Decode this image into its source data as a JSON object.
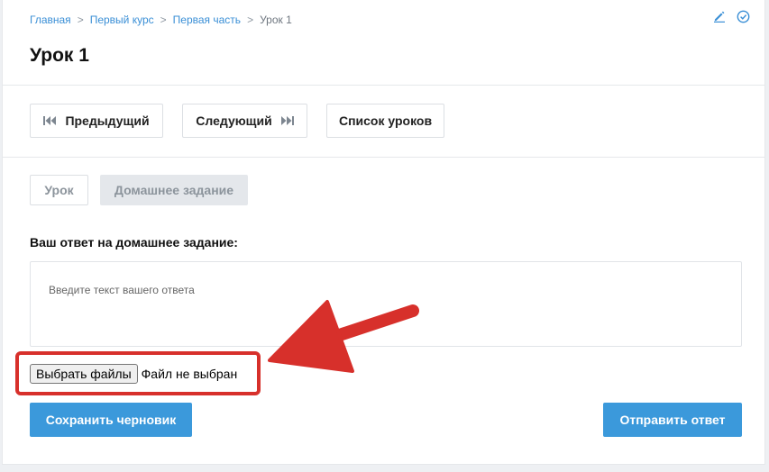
{
  "breadcrumb": {
    "items": [
      "Главная",
      "Первый курс",
      "Первая часть"
    ],
    "current": "Урок 1",
    "separator": ">"
  },
  "header": {
    "title": "Урок 1",
    "icons": [
      "pencil-icon",
      "check-circle-icon"
    ]
  },
  "nav": {
    "prev_label": "Предыдущий",
    "next_label": "Следующий",
    "list_label": "Список уроков"
  },
  "tabs": {
    "lesson_label": "Урок",
    "homework_label": "Домашнее задание",
    "active": "homework"
  },
  "homework": {
    "section_label": "Ваш ответ на домашнее задание:",
    "answer_placeholder": "Введите текст вашего ответа",
    "answer_value": ""
  },
  "file_input": {
    "button_label": "Выбрать файлы",
    "status": "Файл не выбран"
  },
  "actions": {
    "save_draft_label": "Сохранить черновик",
    "submit_label": "Отправить ответ"
  },
  "colors": {
    "link": "#3a8fd6",
    "primary": "#3b99db",
    "annotation": "#d7302b"
  }
}
